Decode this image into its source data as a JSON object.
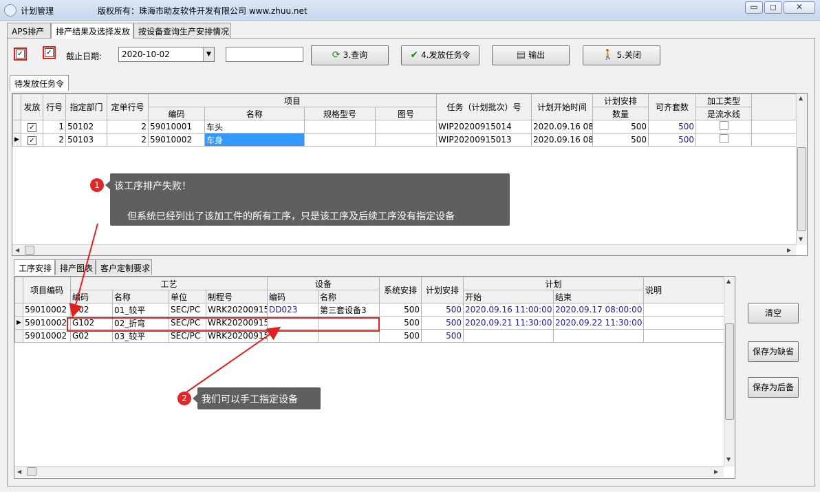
{
  "window": {
    "title": "计划管理",
    "copyright": "版权所有：珠海市助友软件开发有限公司 www.zhuu.net",
    "controls": [
      "▭",
      "◻",
      "✕"
    ]
  },
  "tabs_top": [
    "APS排产",
    "排产结果及选择发放",
    "按设备查询生产安排情况"
  ],
  "filter": {
    "deadline_label": "截止日期:",
    "deadline_value": "2020-10-02",
    "text_value": ""
  },
  "toolbar": {
    "query": "3.查询",
    "release": "4.发放任务令",
    "export": "输出",
    "close": "5.关闭"
  },
  "section_tab": "待发放任务令",
  "upper_grid": {
    "headers": {
      "release": "发放",
      "line_no": "行号",
      "dept": "指定部门",
      "order_line": "定单行号",
      "item": "项目",
      "code": "编码",
      "name": "名称",
      "spec": "规格型号",
      "drawing": "图号",
      "task": "任务（计划批次）号",
      "start": "计划开始时间",
      "plan_qty_1": "计划安排",
      "plan_qty_2": "数量",
      "kit_qty": "可齐套数",
      "proc_type_1": "加工类型",
      "proc_type_2": "是流水线"
    },
    "rows": [
      {
        "release": true,
        "line": "1",
        "dept": "50102",
        "order_line": "2",
        "code": "59010001",
        "name": "车头",
        "spec": "",
        "drawing": "",
        "task": "WIP20200915014",
        "start": "2020.09.16 08:0",
        "qty": "500",
        "kit": "500",
        "flow": false
      },
      {
        "release": true,
        "line": "2",
        "dept": "50103",
        "order_line": "2",
        "code": "59010002",
        "name": "车身",
        "spec": "",
        "drawing": "",
        "task": "WIP20200915013",
        "start": "2020.09.16 08:0",
        "qty": "500",
        "kit": "500",
        "flow": false
      }
    ]
  },
  "tabs_bottom": [
    "工序安排",
    "排产图表",
    "客户定制要求"
  ],
  "lower_grid": {
    "headers": {
      "item_code": "项目编码",
      "craft": "工艺",
      "craft_code": "编码",
      "craft_name": "名称",
      "unit": "单位",
      "process_no": "制程号",
      "equip": "设备",
      "equip_code": "编码",
      "equip_name": "名称",
      "sys_plan": "系统安排",
      "plan_qty": "计划安排",
      "plan": "计划",
      "start": "开始",
      "end": "结束",
      "remark": "说明"
    },
    "rows": [
      {
        "item": "59010002",
        "code": "G02",
        "name": "01_较平",
        "unit": "SEC/PC",
        "proc": "WRK20200915",
        "ecode": "DD023",
        "ename": "第三套设备3",
        "sys": "500",
        "plan": "500",
        "start": "2020.09.16 11:00:00",
        "end": "2020.09.17 08:00:00",
        "remark": ""
      },
      {
        "item": "59010002",
        "code": "G102",
        "name": "02_折弯",
        "unit": "SEC/PC",
        "proc": "WRK20200915",
        "ecode": "",
        "ename": "",
        "sys": "500",
        "plan": "500",
        "start": "2020.09.21 11:30:00",
        "end": "2020.09.22 11:30:00",
        "remark": ""
      },
      {
        "item": "59010002",
        "code": "G02",
        "name": "03_较平",
        "unit": "SEC/PC",
        "proc": "WRK20200915",
        "ecode": "",
        "ename": "",
        "sys": "500",
        "plan": "500",
        "start": "",
        "end": "",
        "remark": ""
      }
    ]
  },
  "side_buttons": {
    "clear": "清空",
    "save_default": "保存为缺省",
    "save_later": "保存为后备"
  },
  "callouts": {
    "one_number": "1",
    "one_line1": "该工序排产失败！",
    "one_line2": "但系统已经列出了该加工件的所有工序，只是该工序及后续工序没有指定设备",
    "two_number": "2",
    "two_text": "我们可以手工指定设备"
  }
}
